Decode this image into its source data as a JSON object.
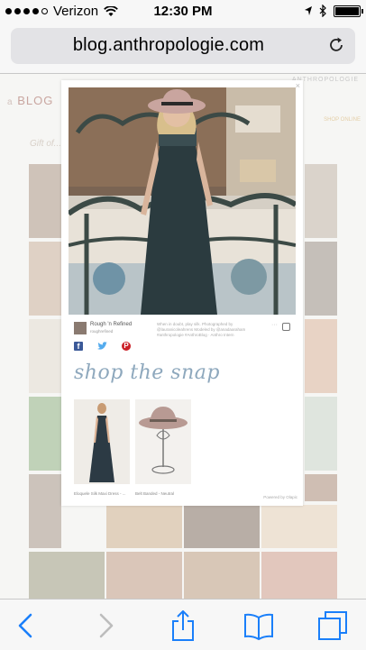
{
  "status_bar": {
    "carrier": "Verizon",
    "time": "12:30 PM",
    "battery_level": 1.0
  },
  "browser": {
    "url": "blog.anthropologie.com"
  },
  "page": {
    "blog_title_small": "a",
    "blog_title": "BLOG",
    "brand": "ANTHROPOLOGIE",
    "shop_online": "SHOP ONLINE",
    "gift_line": "Gift of..."
  },
  "modal": {
    "author_name": "Rough 'n Refined",
    "author_handle": "roughrefined",
    "caption": "When in doubt, play silk. Photographed by @lauranicoleahrens Modeled by @anadaaraham #anthropologie #AnthroBlog · Anthro Intern",
    "shop_title": "shop the snap",
    "products": [
      {
        "label": "Eloquele Silk Maxi Dress - ..."
      },
      {
        "label": "Belt Banded - Neutral"
      }
    ],
    "powered_by": "Powered by Olapic"
  },
  "colors": {
    "facebook": "#3b5998",
    "twitter": "#55acee",
    "pinterest": "#cb2027",
    "shop_snap": "#8ea8bd",
    "ios_blue": "#1a7ffa"
  },
  "icons": [
    "wifi-icon",
    "location-icon",
    "bluetooth-icon",
    "battery-icon",
    "reload-icon",
    "back-icon",
    "forward-icon",
    "share-icon",
    "bookmarks-icon",
    "tabs-icon",
    "facebook-icon",
    "twitter-icon",
    "pinterest-icon",
    "instagram-icon",
    "close-icon"
  ]
}
